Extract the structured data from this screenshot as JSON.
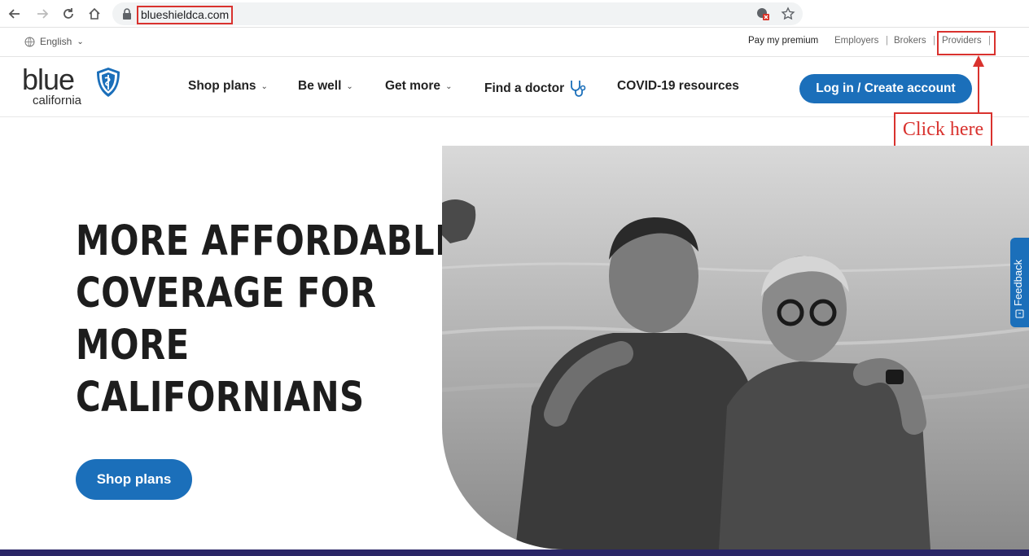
{
  "browser": {
    "url": "blueshieldca.com",
    "icons": [
      "back-icon",
      "forward-icon",
      "reload-icon",
      "home-icon",
      "lock-icon",
      "blocked-icon",
      "star-icon"
    ]
  },
  "utility_bar": {
    "language": "English",
    "links": [
      "Pay my premium",
      "Employers",
      "Brokers",
      "Providers"
    ],
    "separator": "|"
  },
  "logo": {
    "word": "blue",
    "sub": "california"
  },
  "main_nav": {
    "items": [
      "Shop plans",
      "Be well",
      "Get more",
      "Find a doctor",
      "COVID-19 resources"
    ],
    "login": "Log in / Create account"
  },
  "annotation": {
    "text": "Click here",
    "color": "#d9322e"
  },
  "hero": {
    "lines": [
      "MORE AFFORDABLE",
      "COVERAGE FOR",
      "MORE",
      "CALIFORNIANS"
    ],
    "cta": "Shop plans"
  },
  "feedback": {
    "label": "Feedback"
  },
  "colors": {
    "brand": "#1b6fba",
    "annotation": "#d9322e"
  }
}
